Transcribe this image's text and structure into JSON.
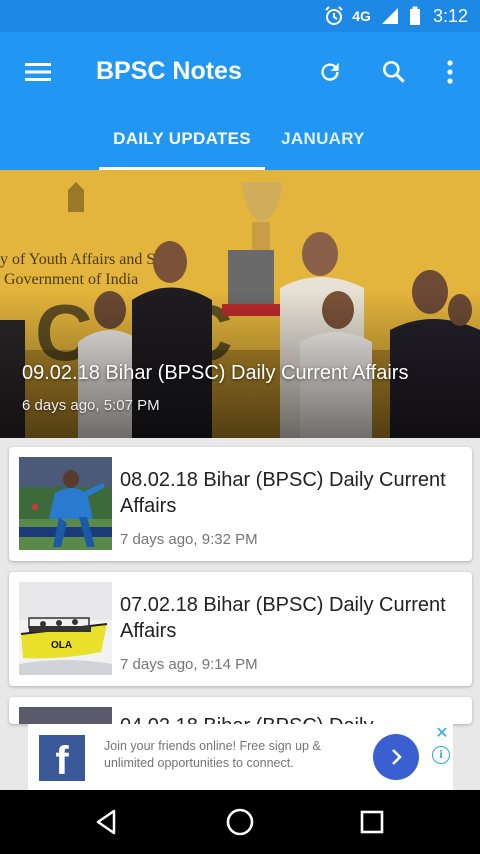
{
  "status_bar": {
    "icons": [
      "alarm-icon",
      "signal-icon",
      "battery-icon"
    ],
    "network": "4G",
    "time": "3:12"
  },
  "app_bar": {
    "title": "BPSC Notes",
    "actions": [
      "refresh-icon",
      "search-icon",
      "more-vert-icon"
    ],
    "background": "#2196f3",
    "status_color": "#1e88e5"
  },
  "tabs": [
    {
      "label": "DAILY UPDATES",
      "active": true
    },
    {
      "label": "JANUARY",
      "active": false
    }
  ],
  "hero": {
    "title": "09.02.18 Bihar (BPSC) Daily Current Affairs",
    "time": "6 days ago, 5:07 PM",
    "backdrop_text_1": "y of Youth Affairs and Sports",
    "backdrop_text_2": "Government of India"
  },
  "cards": [
    {
      "title": "08.02.18 Bihar (BPSC) Daily Current Affairs",
      "time": "7 days ago, 9:32 PM",
      "thumb": "cricket"
    },
    {
      "title": "07.02.18 Bihar (BPSC) Daily Current Affairs",
      "time": "7 days ago, 9:14 PM",
      "thumb": "boat"
    },
    {
      "title": "04.02.18 Bihar (BPSC) Daily",
      "time": "",
      "thumb": "partial"
    }
  ],
  "ad": {
    "logo": "f",
    "text": "Join your friends online! Free sign up & unlimited opportunities to connect.",
    "cta_icon": "chevron-right-icon",
    "close": "✕",
    "info": "i",
    "boat_text": "OLA"
  },
  "nav": [
    "back-icon",
    "home-icon",
    "recents-icon"
  ]
}
